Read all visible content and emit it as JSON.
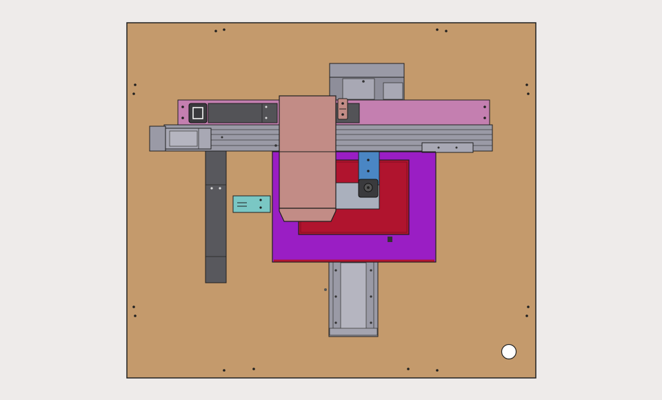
{
  "colors": {
    "background": "#eeebea",
    "baseplate": "#c49a6c",
    "outline": "#1f1f1f",
    "rail_gray": "#9a9aa6",
    "rail_light": "#b5b5c0",
    "rail_dark": "#55555a",
    "beam_pink": "#c47fb0",
    "bracket_dark": "#535357",
    "mount_column": "#58585d",
    "carriage_pink": "#c28c86",
    "platform_purple": "#9a1ec4",
    "platform_red": "#b0142e",
    "plate_blue": "#4a86c4",
    "plate_light": "#aab0bd",
    "teal_part": "#7ac7c4",
    "hole_fill": "#ffffff"
  }
}
